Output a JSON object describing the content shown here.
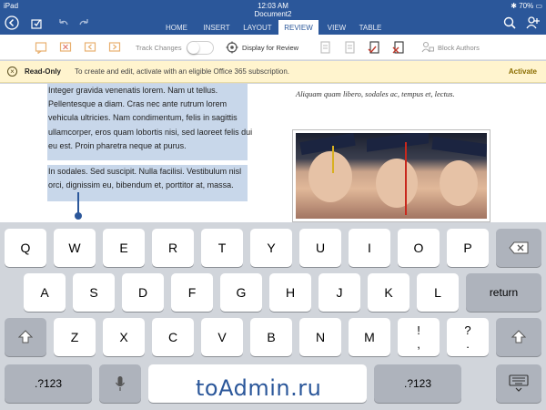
{
  "status_bar": {
    "carrier": "iPad",
    "time": "12:03 AM",
    "battery": "70%"
  },
  "document": {
    "title": "Document2"
  },
  "tabs": [
    {
      "label": "HOME",
      "active": false
    },
    {
      "label": "INSERT",
      "active": false
    },
    {
      "label": "LAYOUT",
      "active": false
    },
    {
      "label": "REVIEW",
      "active": true
    },
    {
      "label": "VIEW",
      "active": false
    },
    {
      "label": "TABLE",
      "active": false
    }
  ],
  "toolbar": {
    "track_changes": "Track Changes",
    "track_changes_on": false,
    "display_for_review": "Display for Review",
    "block_authors": "Block Authors"
  },
  "readonly_bar": {
    "label": "Read-Only",
    "message": "To create and edit, activate with an eligible Office 365 subscription.",
    "action": "Activate"
  },
  "content": {
    "left_para_1": "Integer gravida venenatis lorem. Nam ut tellus. Pellentesque a diam. Cras nec ante rutrum lorem vehicula ultricies. Nam condimentum, felis in sagittis ullamcorper, eros quam lobortis nisi, sed laoreet felis dui eu est. Proin pharetra neque at purus.",
    "left_para_2": "In sodales. Sed suscipit. Nulla facilisi. Vestibulum nisl orci, dignissim eu, bibendum et, porttitor at, massa.",
    "right_para": "Aliquam quam libero, sodales ac, tempus et, lectus."
  },
  "keyboard": {
    "row1": [
      "Q",
      "W",
      "E",
      "R",
      "T",
      "Y",
      "U",
      "I",
      "O",
      "P"
    ],
    "row2": [
      "A",
      "S",
      "D",
      "F",
      "G",
      "H",
      "J",
      "K",
      "L"
    ],
    "row3": [
      "Z",
      "X",
      "C",
      "V",
      "B",
      "N",
      "M"
    ],
    "punct1": [
      "!",
      ","
    ],
    "punct2": [
      "?",
      "."
    ],
    "return": "return",
    "numbers": ".?123"
  },
  "watermark": "toAdmin.ru",
  "colors": {
    "accent": "#2b579a",
    "banner": "#fff4ce",
    "selection": "#c8d7ea"
  }
}
